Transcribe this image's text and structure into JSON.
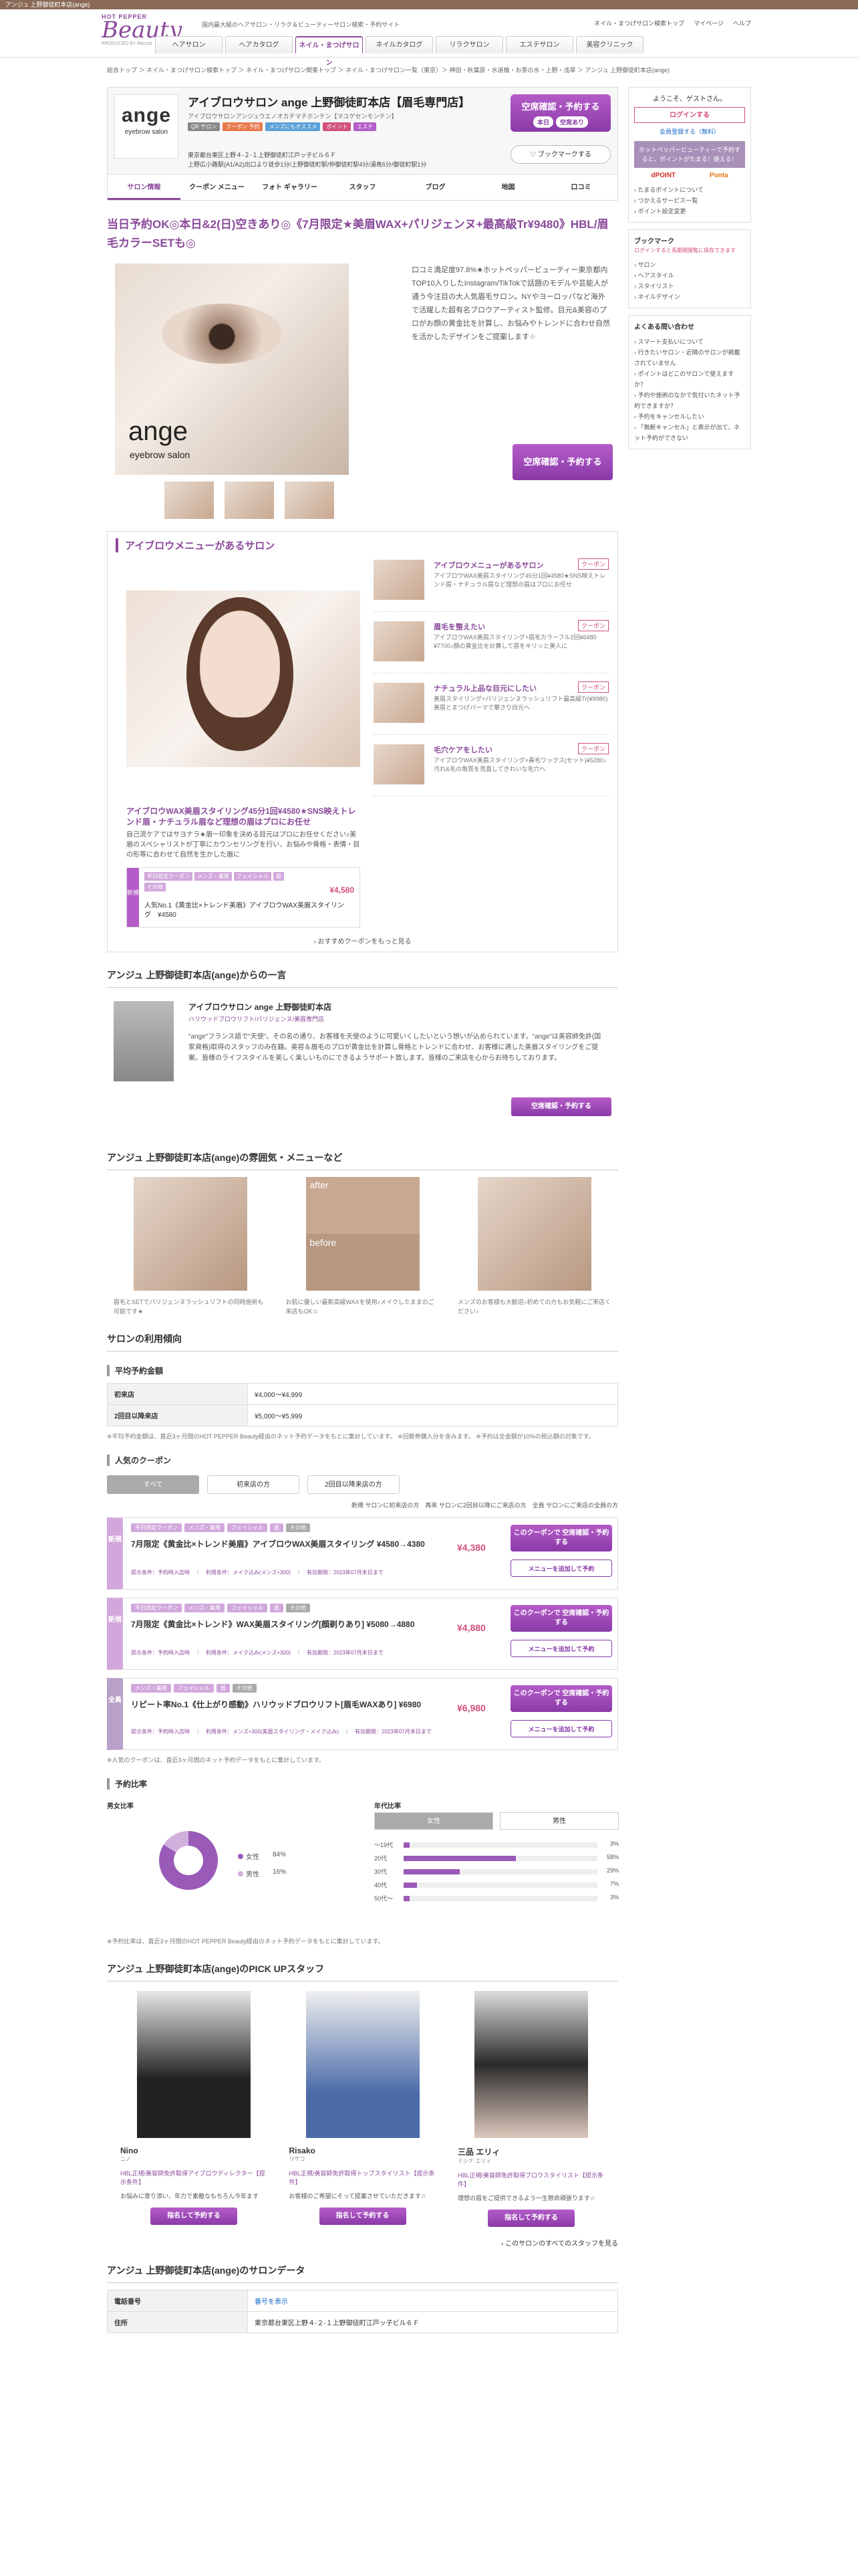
{
  "top_notice": "アンジュ 上野御徒町本店(ange)",
  "header": {
    "brand_small": "HOT PEPPER",
    "brand": "Beauty",
    "brand_sub": "PRODUCED BY Recruit",
    "tagline": "国内最大級のヘアサロン・リラク＆ビューティーサロン検索・予約サイト",
    "links": [
      "ネイル・まつげサロン検索トップ",
      "マイページ",
      "ヘルプ"
    ],
    "nav": [
      "ヘアサロン",
      "ヘアカタログ",
      "ネイル・まつげサロン",
      "ネイルカタログ",
      "リラクサロン",
      "エステサロン",
      "美容クリニック"
    ]
  },
  "breadcrumb": "総合トップ ＞ ネイル・まつげサロン検索トップ ＞ ネイル・まつげサロン関東トップ ＞ ネイル・まつげサロン一覧（東京）＞ 神田・秋葉原・水道橋・お茶の水・上野・浅草 ＞ アンジュ 上野御徒町本店(ange)",
  "salon": {
    "logo_name": "ange",
    "logo_sub": "eyebrow salon",
    "name": "アイブロウサロン ange 上野御徒町本店【眉毛専門店】",
    "kana": "アイブロウサロンアンジュウエノオカチマチホンテン【マユゲセンモンテン】",
    "tags": [
      "QR サロン",
      "クーポン 予約",
      "メンズにもオススメ",
      "ポイント",
      "エステ"
    ],
    "address": "東京都台東区上野４-２-１上野御徒町江戸ッ子ビル６Ｆ",
    "access": "上野広小路駅(A1/A2)出口より徒歩1分/上野御徒町駅/仲御徒町駅4分/湯島5分/御徒町駅1分",
    "reserve": "空席確認・予約する",
    "reserve_tags": [
      "本日",
      "空席あり"
    ],
    "bookmark": "ブックマークする"
  },
  "tabs": [
    "サロン情報",
    "クーポン メニュー",
    "フォト ギャラリー",
    "スタッフ",
    "ブログ",
    "地図",
    "口コミ"
  ],
  "catch": "当日予約OK◎本日&2(日)空きあり◎《7月限定★美眉WAX+パリジェンヌ+最高級Tr¥9480》HBL/眉毛カラーSETも◎",
  "intro": "口コミ満足度97.8%★ホットペッパービューティー東京都内TOP10入りしたInstagram/TikTokで話題のモデルや芸能人が通う今注目の大人気眉毛サロン。NYやヨーロッパなど海外で活躍した超有名ブロウアーティスト監修。目元&美容のプロがお顔の黄金比を計算し、お悩みやトレンドに合わせ自然を活かしたデザインをご提案します☆",
  "photo_watermark": [
    "ange",
    "eyebrow salon"
  ],
  "reserve2": "空席確認・予約する",
  "menubox": {
    "title": "アイブロウメニューがあるサロン",
    "feature_title": "アイブロウWAX美眉スタイリング45分1回¥4580★SNS映えトレンド眉・ナチュラル眉など理想の眉はプロにお任せ",
    "feature_desc": "自己流ケアではサヨナラ★眉一印象を決める目元はプロにお任せください♪美眉のスペシャリストが丁寧にカウンセリングを行い、お悩みや骨格・表情・目の形等に合わせて自然を生かした眉に",
    "coupon_tags": [
      "平日限定クーポン",
      "メンズ・兼用",
      "フェイシャル",
      "眉",
      "その他"
    ],
    "coupon_badge": "新規",
    "coupon_price": "¥4,580",
    "coupon_name": "人気No.1《黄金比×トレンド美眉》アイブロウWAX美眉スタイリング　¥4580",
    "more": "おすすめクーポンをもっと見る",
    "items": [
      {
        "t": "アイブロウメニューがあるサロン",
        "c": "クーポン",
        "d": "アイブロウWAX美眉スタイリング45分1回¥4580★SNS映えトレンド眉・ナチュラル眉など理想の眉はプロにお任せ"
      },
      {
        "t": "眉毛を整えたい",
        "c": "クーポン",
        "d": "アイブロウWAX美眉スタイリング+眉毛カラーフル2回¥6480 ¥7700♪顔の黄金比を計算して眉をキリッと美人に"
      },
      {
        "t": "ナチュラル上品な目元にしたい",
        "c": "クーポン",
        "d": "美眉スタイリング+パリジェンヌラッシュリフト最高級Tr(¥9980) 美眉とまつげパーマで華さり目元へ"
      },
      {
        "t": "毛穴ケアをしたい",
        "c": "クーポン",
        "d": "アイブロウWAX美眉スタイリング+鼻毛ワックス(セット)¥5280♪汚れ&毛の角質を見直してきれいな毛穴へ"
      }
    ]
  },
  "message": {
    "title": "アンジュ 上野御徒町本店(ange)からの一言",
    "name": "アイブロウサロン ange 上野御徒町本店",
    "kana": "ハリウッドブロウリフト/パリジェンヌ/美眉専門店",
    "body": "\"ange\"フランス語で\"天使\"。その名の通り、お客様を天使のように可愛いくしたいという想いが込められています。\"ange\"は美容師免許(国家資格)取得のスタッフのみ在籍。美容＆眉毛のプロが黄金比を計算し骨格とトレンドに合わせ、お客様に適した美眉スタイリングをご提案。皆様のライフスタイルを美しく楽しいものにできるようサポート致します。皆様のご来店を心からお待ちしております。",
    "btn": "空席確認・予約する"
  },
  "gallery": {
    "title": "アンジュ 上野御徒町本店(ange)の雰囲気・メニューなど",
    "items": [
      "眉毛とSETでパリジェンヌラッシュリフトの同時施術も可能です★",
      "お肌に優しい最新高級WAXを使用♪メイクしたままのご来店もOK☺",
      "メンズのお客様も大歓迎♪初めての方もお気軽にご来店ください♪"
    ],
    "labels": [
      "after",
      "before"
    ]
  },
  "usage": {
    "title": "サロンの利用傾向",
    "price_h": "平均予約金額",
    "rows": [
      [
        "初来店",
        "¥4,000〜¥4,999"
      ],
      [
        "2回目以降来店",
        "¥5,000〜¥5,999"
      ]
    ],
    "note": "※平均予約金額は、直近3ヶ月間のHOT PEPPER Beauty経由のネット予約データをもとに集計しています。 ※回数券購入分を含みます。 ※予約は全金額が10%の税込額の対象です。"
  },
  "coupons": {
    "title": "人気のクーポン",
    "tabs": [
      "すべて",
      "初来店の方",
      "2回目以降来店の方"
    ],
    "legend": "新規 サロンに初来店の方　再来 サロンに2回目以降にご来店の方　全員 サロンにご来店の全員の方",
    "btn1": "このクーポンで 空席確認・予約する",
    "btn2": "メニューを追加して予約",
    "list": [
      {
        "badge": "新規",
        "tags": [
          "平日限定クーポン",
          "メンズ・兼用",
          "フェイシャル",
          "眉",
          "その他"
        ],
        "name": "7月限定《黄金比×トレンド美眉》アイブロウWAX美眉スタイリング ¥4580→4380",
        "price": "¥4,380",
        "cond": "提示条件：予約時入店時　｜　利用条件：メイク込み(メンズ+300)　｜　有効期限：2023年07月末日まで"
      },
      {
        "badge": "新規",
        "tags": [
          "平日限定クーポン",
          "メンズ・兼用",
          "フェイシャル",
          "眉",
          "その他"
        ],
        "name": "7月限定《黄金比×トレンド》WAX美眉スタイリング[顔剃りあり] ¥5080→4880",
        "price": "¥4,880",
        "cond": "提示条件：予約時入店時　｜　利用条件：メイク込み(メンズ+300)　｜　有効期限：2023年07月末日まで"
      },
      {
        "badge": "全員",
        "tags": [
          "メンズ・兼用",
          "フェイシャル",
          "眉",
          "その他"
        ],
        "name": "リピート率No.1《仕上がり感動》ハリウッドブロウリフト[眉毛WAXあり] ¥6980",
        "price": "¥6,980",
        "cond": "提示条件：予約時入店時　｜　利用条件：メンズ+300(美眉スタイリング・メイク込み)　｜　有効期限：2023年07月末日まで"
      }
    ],
    "note": "※人気のクーポンは、直近3ヶ月間のネット予約データをもとに集計しています。"
  },
  "ratio": {
    "title": "予約比率",
    "gender_h": "男女比率",
    "age_h": "年代比率",
    "female_label": "女性",
    "female": "84%",
    "female_value": 84,
    "male_label": "男性",
    "male": "16%",
    "male_value": 16,
    "gender_tabs": [
      "女性",
      "男性"
    ],
    "ages": [
      {
        "l": "〜19代",
        "p": "3%",
        "v": 3
      },
      {
        "l": "20代",
        "p": "58%",
        "v": 58
      },
      {
        "l": "30代",
        "p": "29%",
        "v": 29
      },
      {
        "l": "40代",
        "p": "7%",
        "v": 7
      },
      {
        "l": "50代〜",
        "p": "3%",
        "v": 3
      }
    ],
    "note": "※予約比率は、直近3ヶ月間のHOT PEPPER Beauty経由のネット予約データをもとに集計しています。"
  },
  "staff": {
    "title": "アンジュ 上野御徒町本店(ange)のPICK UPスタッフ",
    "list": [
      {
        "name": "Nino",
        "kana": "ニノ",
        "title": "HBL正規/美容師免許取得アイブロウディレクター【提示条件】",
        "desc": "お悩みに寄り添い、年力で素敵なもちろん今年ます",
        "btn": "指名して予約する"
      },
      {
        "name": "Risako",
        "kana": "リサコ",
        "title": "HBL正規/美容師免許取得トップスタイリスト【提示条件】",
        "desc": "お客様のご希望にそって提案させていただきます☆",
        "btn": "指名して予約する"
      },
      {
        "name": "三品 エリィ",
        "kana": "ミシナ エリィ",
        "title": "HBL正規/美容師免許取得ブロウスタイリスト【提示条件】",
        "desc": "理想の眉をご提供できるよう一生懸命頑張ります☆",
        "btn": "指名して予約する"
      }
    ],
    "more": "このサロンのすべてのスタッフを見る"
  },
  "salondata": {
    "title": "アンジュ 上野御徒町本店(ange)のサロンデータ",
    "rows": [
      [
        "電話番号",
        "番号を表示"
      ],
      [
        "住所",
        "東京都台東区上野４-２-１上野御徒町江戸ッ子ビル６Ｆ"
      ]
    ]
  },
  "sidebar": {
    "greet": "ようこそ、ゲストさん。",
    "login": "ログインする",
    "register": "会員登録する（無料）",
    "promo": "ホットペッパービューティーで予約すると、ポイントがたまる！使える！",
    "brands": [
      "dPOINT",
      "Ponta"
    ],
    "links": [
      "たまるポイントについて",
      "つかえるサービス一覧",
      "ポイント設定変更"
    ],
    "bm_h": "ブックマーク",
    "bm_note": "ログインすると長期間閲覧に保存できます",
    "bm_links": [
      "サロン",
      "ヘアスタイル",
      "スタイリスト",
      "ネイルデザイン"
    ],
    "faq_h": "よくある問い合わせ",
    "faq": [
      "スマート支払いについて",
      "行きたいサロン・近隣のサロンが掲載されていません",
      "ポイントはどこのサロンで使えますか？",
      "予約や施術のなかで気付いたネット予約できますか？",
      "予約をキャンセルしたい",
      "「無断キャンセル」と表示が出て、ネット予約ができない"
    ]
  }
}
